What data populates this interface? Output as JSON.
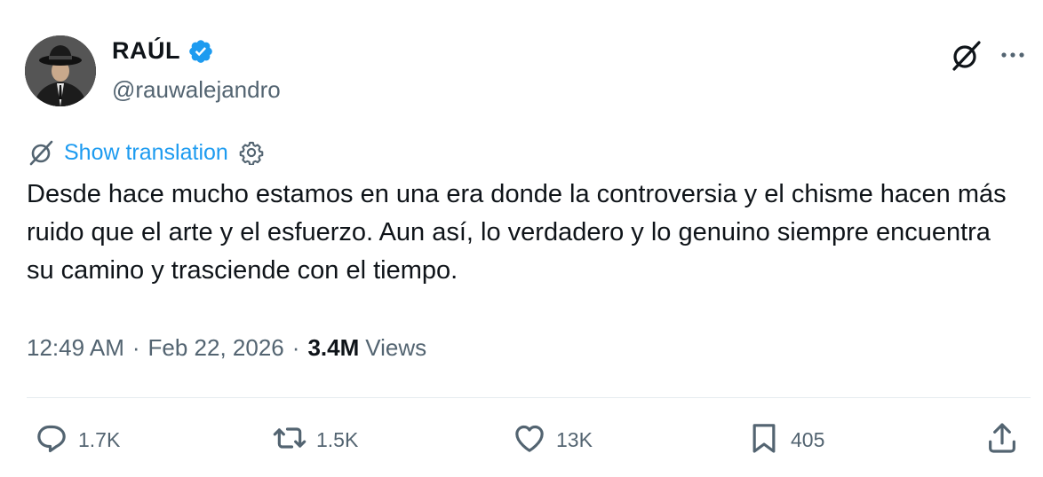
{
  "author": {
    "name": "RAÚL",
    "handle": "@rauwalejandro",
    "verified": true,
    "verified_color": "#1d9bf0"
  },
  "translate": {
    "label": "Show translation"
  },
  "post": {
    "text": "Desde hace mucho estamos en una era donde la controversia y el chisme hacen más ruido que el arte y el esfuerzo. Aun así, lo verdadero y lo genuino siempre encuentra su camino y trasciende con el tiempo."
  },
  "meta": {
    "time": "12:49 AM",
    "separator": "·",
    "date": "Feb 22, 2026",
    "views_count": "3.4M",
    "views_label": "Views"
  },
  "actions": {
    "replies": "1.7K",
    "reposts": "1.5K",
    "likes": "13K",
    "bookmarks": "405"
  },
  "icons": {
    "verified": "verified-badge-icon",
    "grok": "grok-icon",
    "more": "more-icon",
    "translate": "translate-icon",
    "settings": "gear-icon",
    "reply": "reply-icon",
    "repost": "repost-icon",
    "like": "heart-icon",
    "bookmark": "bookmark-icon",
    "share": "share-icon"
  },
  "colors": {
    "text": "#0f1419",
    "secondary": "#536471",
    "link": "#1d9bf0",
    "divider": "#e6ecf0"
  }
}
